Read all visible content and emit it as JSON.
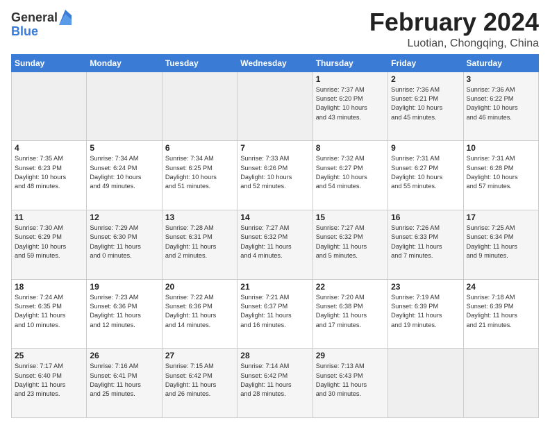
{
  "logo": {
    "general": "General",
    "blue": "Blue"
  },
  "title": {
    "month": "February 2024",
    "location": "Luotian, Chongqing, China"
  },
  "headers": [
    "Sunday",
    "Monday",
    "Tuesday",
    "Wednesday",
    "Thursday",
    "Friday",
    "Saturday"
  ],
  "weeks": [
    [
      {
        "day": "",
        "info": ""
      },
      {
        "day": "",
        "info": ""
      },
      {
        "day": "",
        "info": ""
      },
      {
        "day": "",
        "info": ""
      },
      {
        "day": "1",
        "info": "Sunrise: 7:37 AM\nSunset: 6:20 PM\nDaylight: 10 hours\nand 43 minutes."
      },
      {
        "day": "2",
        "info": "Sunrise: 7:36 AM\nSunset: 6:21 PM\nDaylight: 10 hours\nand 45 minutes."
      },
      {
        "day": "3",
        "info": "Sunrise: 7:36 AM\nSunset: 6:22 PM\nDaylight: 10 hours\nand 46 minutes."
      }
    ],
    [
      {
        "day": "4",
        "info": "Sunrise: 7:35 AM\nSunset: 6:23 PM\nDaylight: 10 hours\nand 48 minutes."
      },
      {
        "day": "5",
        "info": "Sunrise: 7:34 AM\nSunset: 6:24 PM\nDaylight: 10 hours\nand 49 minutes."
      },
      {
        "day": "6",
        "info": "Sunrise: 7:34 AM\nSunset: 6:25 PM\nDaylight: 10 hours\nand 51 minutes."
      },
      {
        "day": "7",
        "info": "Sunrise: 7:33 AM\nSunset: 6:26 PM\nDaylight: 10 hours\nand 52 minutes."
      },
      {
        "day": "8",
        "info": "Sunrise: 7:32 AM\nSunset: 6:27 PM\nDaylight: 10 hours\nand 54 minutes."
      },
      {
        "day": "9",
        "info": "Sunrise: 7:31 AM\nSunset: 6:27 PM\nDaylight: 10 hours\nand 55 minutes."
      },
      {
        "day": "10",
        "info": "Sunrise: 7:31 AM\nSunset: 6:28 PM\nDaylight: 10 hours\nand 57 minutes."
      }
    ],
    [
      {
        "day": "11",
        "info": "Sunrise: 7:30 AM\nSunset: 6:29 PM\nDaylight: 10 hours\nand 59 minutes."
      },
      {
        "day": "12",
        "info": "Sunrise: 7:29 AM\nSunset: 6:30 PM\nDaylight: 11 hours\nand 0 minutes."
      },
      {
        "day": "13",
        "info": "Sunrise: 7:28 AM\nSunset: 6:31 PM\nDaylight: 11 hours\nand 2 minutes."
      },
      {
        "day": "14",
        "info": "Sunrise: 7:27 AM\nSunset: 6:32 PM\nDaylight: 11 hours\nand 4 minutes."
      },
      {
        "day": "15",
        "info": "Sunrise: 7:27 AM\nSunset: 6:32 PM\nDaylight: 11 hours\nand 5 minutes."
      },
      {
        "day": "16",
        "info": "Sunrise: 7:26 AM\nSunset: 6:33 PM\nDaylight: 11 hours\nand 7 minutes."
      },
      {
        "day": "17",
        "info": "Sunrise: 7:25 AM\nSunset: 6:34 PM\nDaylight: 11 hours\nand 9 minutes."
      }
    ],
    [
      {
        "day": "18",
        "info": "Sunrise: 7:24 AM\nSunset: 6:35 PM\nDaylight: 11 hours\nand 10 minutes."
      },
      {
        "day": "19",
        "info": "Sunrise: 7:23 AM\nSunset: 6:36 PM\nDaylight: 11 hours\nand 12 minutes."
      },
      {
        "day": "20",
        "info": "Sunrise: 7:22 AM\nSunset: 6:36 PM\nDaylight: 11 hours\nand 14 minutes."
      },
      {
        "day": "21",
        "info": "Sunrise: 7:21 AM\nSunset: 6:37 PM\nDaylight: 11 hours\nand 16 minutes."
      },
      {
        "day": "22",
        "info": "Sunrise: 7:20 AM\nSunset: 6:38 PM\nDaylight: 11 hours\nand 17 minutes."
      },
      {
        "day": "23",
        "info": "Sunrise: 7:19 AM\nSunset: 6:39 PM\nDaylight: 11 hours\nand 19 minutes."
      },
      {
        "day": "24",
        "info": "Sunrise: 7:18 AM\nSunset: 6:39 PM\nDaylight: 11 hours\nand 21 minutes."
      }
    ],
    [
      {
        "day": "25",
        "info": "Sunrise: 7:17 AM\nSunset: 6:40 PM\nDaylight: 11 hours\nand 23 minutes."
      },
      {
        "day": "26",
        "info": "Sunrise: 7:16 AM\nSunset: 6:41 PM\nDaylight: 11 hours\nand 25 minutes."
      },
      {
        "day": "27",
        "info": "Sunrise: 7:15 AM\nSunset: 6:42 PM\nDaylight: 11 hours\nand 26 minutes."
      },
      {
        "day": "28",
        "info": "Sunrise: 7:14 AM\nSunset: 6:42 PM\nDaylight: 11 hours\nand 28 minutes."
      },
      {
        "day": "29",
        "info": "Sunrise: 7:13 AM\nSunset: 6:43 PM\nDaylight: 11 hours\nand 30 minutes."
      },
      {
        "day": "",
        "info": ""
      },
      {
        "day": "",
        "info": ""
      }
    ]
  ]
}
